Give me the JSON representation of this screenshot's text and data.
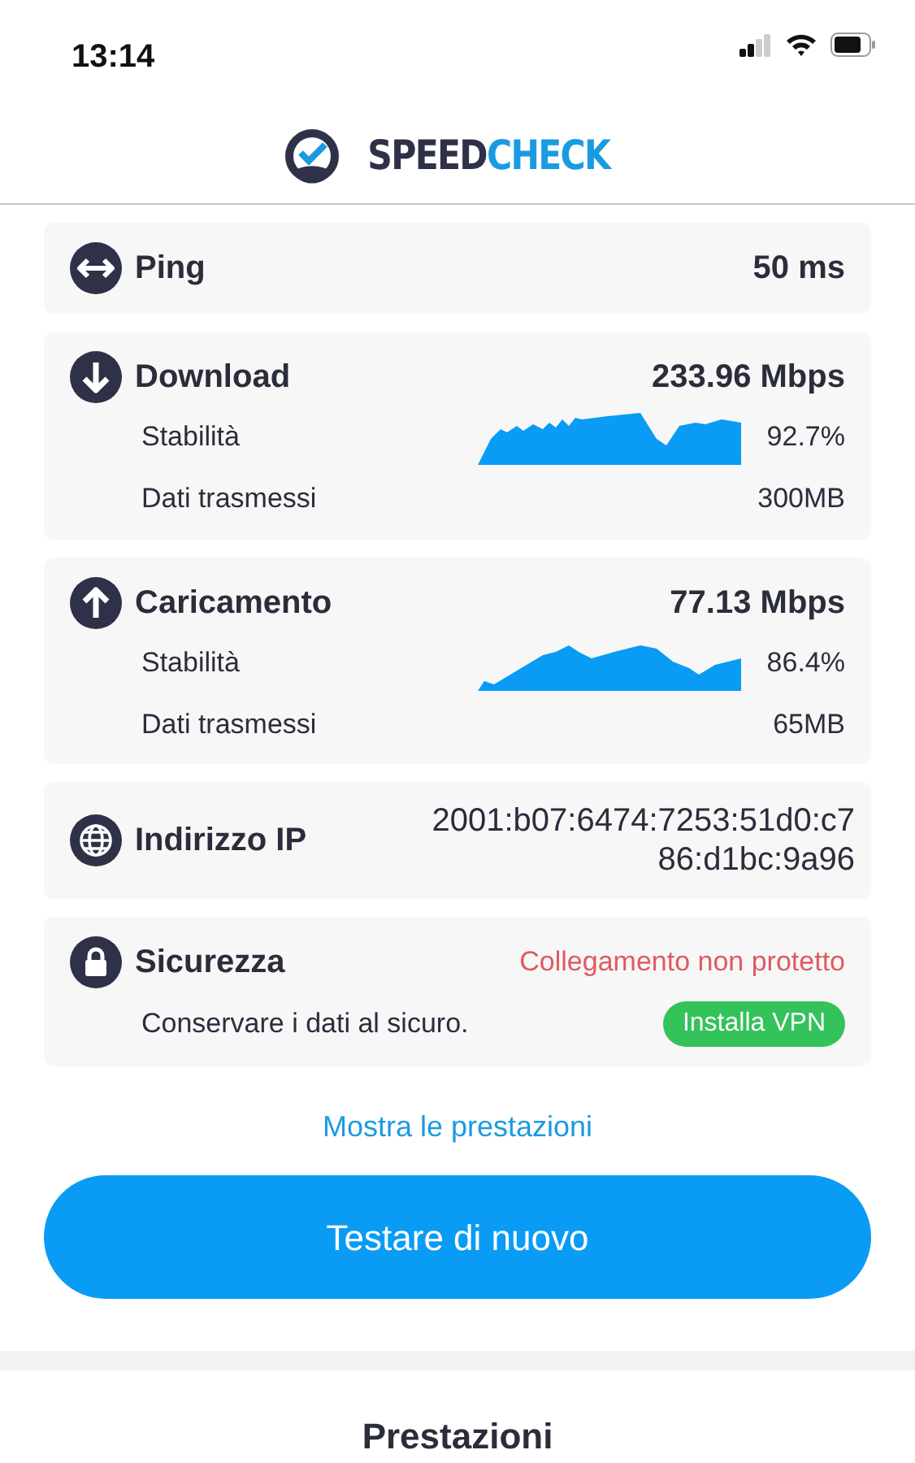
{
  "status_bar": {
    "time": "13:14"
  },
  "header": {
    "logo_first": "SPEED",
    "logo_second": "CHECK"
  },
  "cards": [
    {
      "kind": "ping",
      "title": "Ping",
      "value": "50 ms"
    },
    {
      "kind": "download",
      "title": "Download",
      "value": "233.96 Mbps",
      "stability_label": "Stabilità",
      "stability": "92.7%",
      "data_label": "Dati trasmessi",
      "data": "300MB"
    },
    {
      "kind": "upload",
      "title": "Caricamento",
      "value": "77.13 Mbps",
      "stability_label": "Stabilità",
      "stability": "86.4%",
      "data_label": "Dati trasmessi",
      "data": "65MB"
    },
    {
      "kind": "ip",
      "title": "Indirizzo IP",
      "value_lines": [
        "2001:b07:6474:7253:51d0:c7",
        "86:d1bc:9a96"
      ]
    },
    {
      "kind": "security",
      "title": "Sicurezza",
      "status": "Collegamento non protetto",
      "note": "Conservare i dati al sicuro.",
      "action": "Installa VPN"
    }
  ],
  "link": "Mostra le prestazioni",
  "button": "Testare di nuovo",
  "section_title": "Prestazioni"
}
